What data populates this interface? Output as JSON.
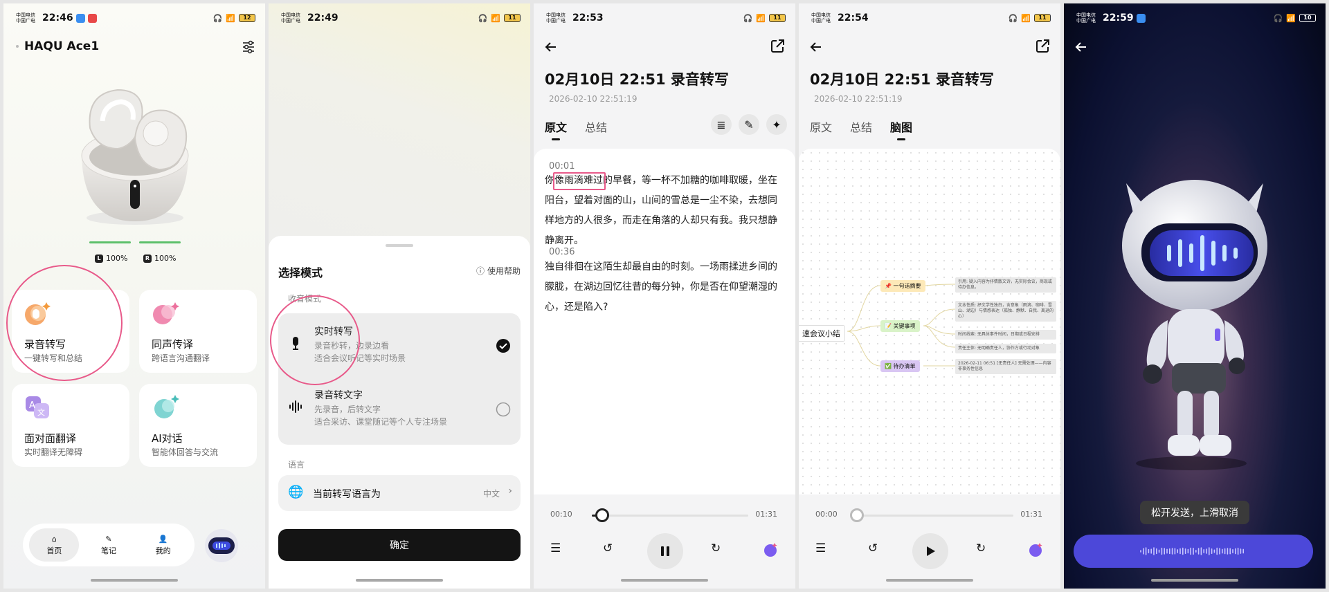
{
  "screens": {
    "home": {
      "status": {
        "carrier": "中国电信\n中国广电",
        "time": "22:46",
        "battery": "12"
      },
      "device_name": "HAQU Ace1",
      "battery": {
        "left_label": "L",
        "left": "100%",
        "right_label": "R",
        "right": "100%"
      },
      "cards": [
        {
          "title": "录音转写",
          "sub": "一键转写和总结"
        },
        {
          "title": "同声传译",
          "sub": "跨语言沟通翻译"
        },
        {
          "title": "面对面翻译",
          "sub": "实时翻译无障碍"
        },
        {
          "title": "AI对话",
          "sub": "智能体回答与交流"
        }
      ],
      "nav": [
        "首页",
        "笔记",
        "我的"
      ]
    },
    "mode": {
      "status": {
        "carrier": "中国电信\n中国广电",
        "time": "22:49",
        "battery": "11"
      },
      "sheet_title": "选择模式",
      "help": "使用帮助",
      "section_capture": "收音模式",
      "options": [
        {
          "title": "实时转写",
          "desc1": "录音秒转，边录边看",
          "desc2": "适合会议听记等实时场景",
          "selected": true
        },
        {
          "title": "录音转文字",
          "desc1": "先录音，后转文字",
          "desc2": "适合采访、课堂随记等个人专注场景",
          "selected": false
        }
      ],
      "section_language": "语言",
      "language_label": "当前转写语言为",
      "language_value": "中文",
      "confirm": "确定"
    },
    "transcript": {
      "status": {
        "carrier": "中国电信\n中国广电",
        "time": "22:53",
        "battery": "11"
      },
      "title": "02月10日 22:51 录音转写",
      "date": "2026-02-10 22:51:19",
      "tabs": [
        "原文",
        "总结"
      ],
      "segments": [
        {
          "time": "00:01",
          "pre": "你",
          "highlight": "像雨滴难过",
          "post": "的早餐，等一杯不加糖的咖啡取暖，坐在阳台，望着对面的山，山间的雪总是一尘不染，去想同样地方的人很多，而走在角落的人却只有我。我只想静静离开。"
        },
        {
          "time": "00:36",
          "text": "独自徘徊在这陌生却最自由的时刻。一场雨揉进乡间的朦胧，在湖边回忆往昔的每分钟，你是否在仰望潮湿的心，还是陷入?"
        }
      ],
      "player": {
        "current": "00:10",
        "total": "01:31",
        "progress": 0.065
      }
    },
    "mindmap": {
      "status": {
        "carrier": "中国电信\n中国广电",
        "time": "22:54",
        "battery": "11"
      },
      "title": "02月10日 22:51 录音转写",
      "date": "2026-02-10 22:51:19",
      "tabs": [
        "原文",
        "总结",
        "脑图"
      ],
      "root": "速会议小结",
      "branches": [
        {
          "label": "📌 一句话摘要",
          "color": "#fde9b8",
          "leaves": [
            "引用: 疑入内容为抒情散文诗，无实际会议，商现或待办信息。"
          ]
        },
        {
          "label": "📝 关键事项",
          "color": "#d9f3c8",
          "leaves": [
            "文本性质: 抒文学性独白，含意象（雨滴、咖啡、雪山、湖边）与情感表达（孤独、静默、自我、离退的心）",
            "时间线索: 无具体事件时间，日期或日程安排",
            "责任主体: 无明确责任人，协作方或行动对象"
          ]
        },
        {
          "label": "✅ 待办清单",
          "color": "#d9c6f3",
          "leaves": [
            "2026-02-11 06:51 [无责任人] 无需处理——内容非事务性信息"
          ]
        }
      ],
      "player": {
        "current": "00:00",
        "total": "01:31",
        "progress": 0.0
      }
    },
    "voice": {
      "status": {
        "carrier": "中国电信\n中国广电",
        "time": "22:59",
        "battery": "10"
      },
      "toast": "松开发送，上滑取消"
    }
  }
}
